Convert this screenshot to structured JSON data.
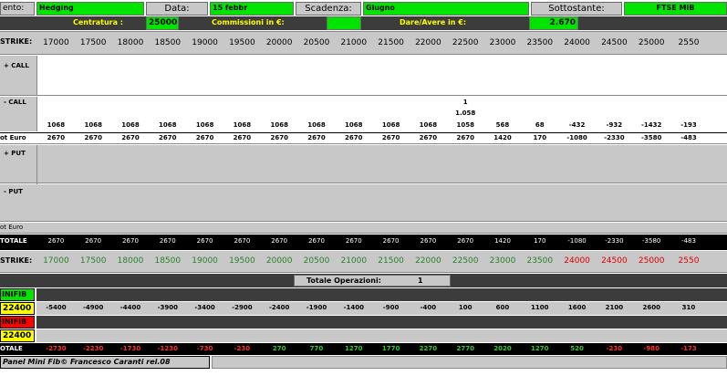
{
  "header": {
    "strategy_label": "ento:",
    "strategy_value": "Hedging",
    "date_label": "Data:",
    "date_value": "15 febbr",
    "expiry_label": "Scadenza:",
    "expiry_value": "Giugno",
    "underlying_label": "Sottostante:",
    "underlying_value": "FTSE MIB",
    "centering_label": "Centratura :",
    "centering_value": "25000",
    "commission_label": "Commissioni in €:",
    "commission_value": "",
    "balance_label": "Dare/Avere in €:",
    "balance_value": "2.670"
  },
  "labels": {
    "strike": "STRIKE:",
    "plus_call": "+ CALL",
    "minus_call": "- CALL",
    "tot_euro_1": "ot Euro",
    "plus_put": "+ PUT",
    "minus_put": "- PUT",
    "tot_euro_2": "ot Euro",
    "totale": "TOTALE",
    "strike2": "STRIKE:",
    "total_ops_label": "Totale Operazioni:",
    "total_ops_value": "1",
    "minifib_1": "INIFIB",
    "minifib_1_value": "22400",
    "minifib_2": "INIFIB",
    "minifib_2_value": "22400",
    "totale_bottom": "OTALE",
    "footer": "Panel Mini Fib© Francesco Caranti rel.08"
  },
  "strikes": [
    "17000",
    "17500",
    "18000",
    "18500",
    "19000",
    "19500",
    "20000",
    "20500",
    "21000",
    "21500",
    "22000",
    "22500",
    "23000",
    "23500",
    "24000",
    "24500",
    "25000",
    "2550"
  ],
  "minus_call_qty": {
    "index": 11,
    "value": "1",
    "price": "1.058"
  },
  "minus_call_values": [
    "1068",
    "1068",
    "1068",
    "1068",
    "1068",
    "1068",
    "1068",
    "1068",
    "1068",
    "1068",
    "1068",
    "1058",
    "568",
    "68",
    "-432",
    "-932",
    "-1432",
    "-193"
  ],
  "tot_euro_values": [
    "2670",
    "2670",
    "2670",
    "2670",
    "2670",
    "2670",
    "2670",
    "2670",
    "2670",
    "2670",
    "2670",
    "2670",
    "1420",
    "170",
    "-1080",
    "-2330",
    "-3580",
    "-483"
  ],
  "totale_values": [
    "2670",
    "2670",
    "2670",
    "2670",
    "2670",
    "2670",
    "2670",
    "2670",
    "2670",
    "2670",
    "2670",
    "2670",
    "1420",
    "170",
    "-1080",
    "-2330",
    "-3580",
    "-483"
  ],
  "strike2_colors": [
    "g",
    "g",
    "g",
    "g",
    "g",
    "g",
    "g",
    "g",
    "g",
    "g",
    "g",
    "g",
    "g",
    "g",
    "r",
    "r",
    "r",
    "r"
  ],
  "minifib_values": [
    "-5400",
    "-4900",
    "-4400",
    "-3900",
    "-3400",
    "-2900",
    "-2400",
    "-1900",
    "-1400",
    "-900",
    "-400",
    "100",
    "600",
    "1100",
    "1600",
    "2100",
    "2600",
    "310"
  ],
  "bottom_totale_values": [
    "-2730",
    "-2230",
    "-1730",
    "-1230",
    "-730",
    "-230",
    "270",
    "770",
    "1270",
    "1770",
    "2270",
    "2770",
    "2020",
    "1270",
    "520",
    "-230",
    "-980",
    "-173"
  ],
  "colors": {
    "green": "#00e400",
    "yellow": "#ffff00",
    "red": "#ff0000",
    "dark": "#3c3c3c"
  }
}
